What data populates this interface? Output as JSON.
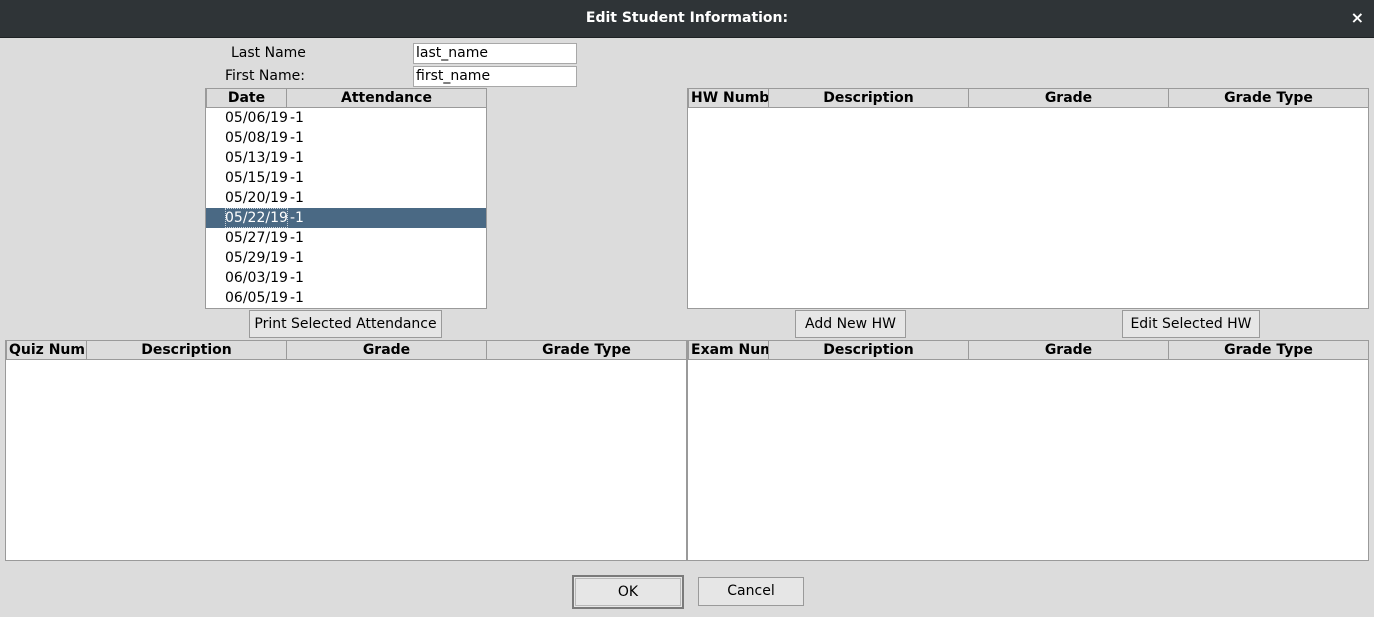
{
  "window": {
    "title": "Edit Student Information:",
    "close_glyph": "×"
  },
  "form": {
    "last_name_label": "Last Name",
    "last_name_value": "last_name",
    "first_name_label": "First Name:",
    "first_name_value": "first_name"
  },
  "attendance": {
    "headers": [
      "Date",
      "Attendance"
    ],
    "rows": [
      {
        "date": "05/06/19",
        "value": "-1"
      },
      {
        "date": "05/08/19",
        "value": "-1"
      },
      {
        "date": "05/13/19",
        "value": "-1"
      },
      {
        "date": "05/15/19",
        "value": "-1"
      },
      {
        "date": "05/20/19",
        "value": "-1"
      },
      {
        "date": "05/22/19",
        "value": "-1",
        "selected": true
      },
      {
        "date": "05/27/19",
        "value": "-1"
      },
      {
        "date": "05/29/19",
        "value": "-1"
      },
      {
        "date": "06/03/19",
        "value": "-1"
      },
      {
        "date": "06/05/19",
        "value": "-1"
      }
    ],
    "print_button": "Print Selected Attendance"
  },
  "hw_table": {
    "headers": [
      "HW Numbe",
      "Description",
      "Grade",
      "Grade Type"
    ],
    "add_button": "Add New HW",
    "edit_button": "Edit Selected HW"
  },
  "quiz_table": {
    "headers": [
      "Quiz Numb",
      "Description",
      "Grade",
      "Grade Type"
    ]
  },
  "exam_table": {
    "headers": [
      "Exam Num",
      "Description",
      "Grade",
      "Grade Type"
    ]
  },
  "footer": {
    "ok_label": "OK",
    "cancel_label": "Cancel"
  },
  "colors": {
    "titlebar": "#2f3437",
    "selection": "#4a6984",
    "background": "#dcdcdc"
  }
}
